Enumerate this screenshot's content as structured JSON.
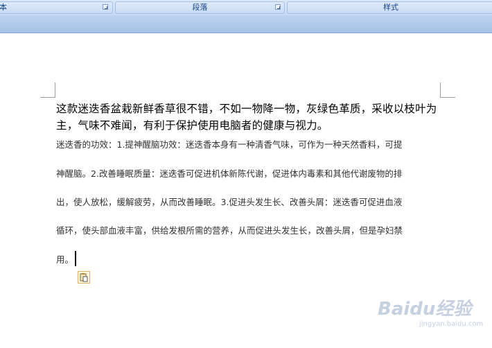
{
  "ribbon": {
    "groups": [
      {
        "label": "本"
      },
      {
        "label": "段落"
      },
      {
        "label": "样式"
      }
    ]
  },
  "document": {
    "paragraph1": "这款迷迭香盆栽新鲜香草很不错，不如一物降一物，灰绿色革质，采收以枝叶为主，气味不难闻，有利于保护使用电脑者的健康与视力。",
    "paragraph2_lines": [
      "迷迭香的功效：1.提神醒脑功效：迷迭香本身有一种清香气味，可作为一种天然香料，可提",
      "神醒脑。2.改善睡眠质量：迷迭香可促进机体新陈代谢，促进体内毒素和其他代谢废物的排",
      "出，使人放松，缓解疲劳，从而改善睡眠。3.促进头发生长、改善头屑：迷迭香可促进血液",
      "循环，使头部血液丰富，供给发根所需的营养，从而促进头发生长，改善头屑，但是孕妇禁",
      "用。"
    ]
  },
  "icons": {
    "paste_options": "paste-options-icon",
    "launcher": "dialog-launcher-icon"
  },
  "watermark": {
    "brand": "Baidu经验",
    "url": "jingyan.baidu.com"
  },
  "colors": {
    "ribbon_text": "#15428b",
    "ribbon_bg": "#c9dcf3"
  }
}
